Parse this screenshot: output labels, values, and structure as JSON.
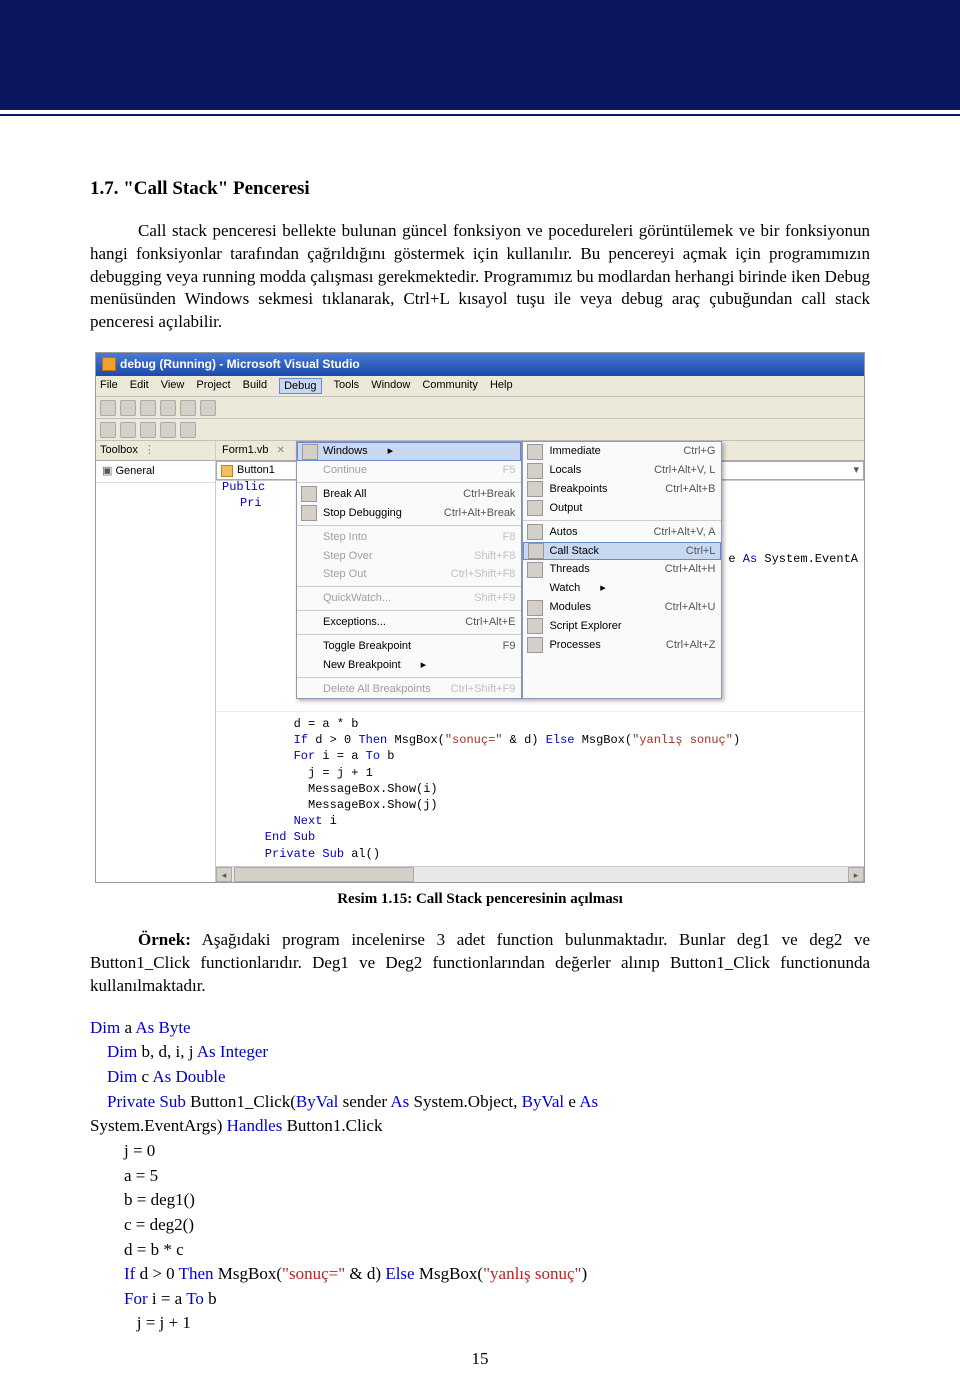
{
  "heading": "1.7. \"Call Stack\" Penceresi",
  "para1": "Call stack penceresi bellekte bulunan güncel fonksiyon ve pocedureleri görüntülemek ve bir fonksiyonun hangi fonksiyonlar tarafından çağrıldığını göstermek için kullanılır. Bu pencereyi açmak için programımızın debugging veya running modda çalışması gerekmektedir. Programımız bu modlardan herhangi birinde iken Debug menüsünden Windows sekmesi tıklanarak, Ctrl+L kısayol tuşu ile veya debug araç çubuğundan call stack penceresi açılabilir.",
  "shot": {
    "title": "debug (Running) - Microsoft Visual Studio",
    "menubar": [
      "File",
      "Edit",
      "View",
      "Project",
      "Build",
      "Debug",
      "Tools",
      "Window",
      "Community",
      "Help"
    ],
    "menubar_selected": "Debug",
    "toolbox": "Toolbox",
    "general": "General",
    "tab": "Form1.vb",
    "dd_button": "Button1",
    "debug_menu": [
      {
        "label": "Windows",
        "sel": true,
        "arrow": true
      },
      {
        "label": "Continue",
        "dis": true,
        "sc": "F5"
      },
      {
        "sep": true
      },
      {
        "label": "Break All",
        "sc": "Ctrl+Break",
        "icon": true
      },
      {
        "label": "Stop Debugging",
        "sc": "Ctrl+Alt+Break",
        "icon": true
      },
      {
        "sep": true
      },
      {
        "label": "Step Into",
        "dis": true,
        "sc": "F8"
      },
      {
        "label": "Step Over",
        "dis": true,
        "sc": "Shift+F8"
      },
      {
        "label": "Step Out",
        "dis": true,
        "sc": "Ctrl+Shift+F8"
      },
      {
        "sep": true
      },
      {
        "label": "QuickWatch...",
        "dis": true,
        "sc": "Shift+F9"
      },
      {
        "sep": true
      },
      {
        "label": "Exceptions...",
        "sc": "Ctrl+Alt+E"
      },
      {
        "sep": true
      },
      {
        "label": "Toggle Breakpoint",
        "sc": "F9"
      },
      {
        "label": "New Breakpoint",
        "arrow": true
      },
      {
        "sep": true
      },
      {
        "label": "Delete All Breakpoints",
        "dis": true,
        "sc": "Ctrl+Shift+F9"
      }
    ],
    "windows_menu": [
      {
        "label": "Immediate",
        "sc": "Ctrl+G",
        "icon": true
      },
      {
        "label": "Locals",
        "sc": "Ctrl+Alt+V, L",
        "icon": true
      },
      {
        "label": "Breakpoints",
        "sc": "Ctrl+Alt+B",
        "icon": true
      },
      {
        "label": "Output",
        "icon": true
      },
      {
        "sep": true
      },
      {
        "label": "Autos",
        "sc": "Ctrl+Alt+V, A",
        "icon": true
      },
      {
        "label": "Call Stack",
        "sc": "Ctrl+L",
        "sel": true,
        "icon": true
      },
      {
        "label": "Threads",
        "sc": "Ctrl+Alt+H",
        "icon": true
      },
      {
        "label": "Watch",
        "arrow": true
      },
      {
        "label": "Modules",
        "sc": "Ctrl+Alt+U",
        "icon": true
      },
      {
        "label": "Script Explorer",
        "icon": true
      },
      {
        "label": "Processes",
        "sc": "Ctrl+Alt+Z",
        "icon": true
      }
    ],
    "code_snippet": {
      "pub": "Public",
      "pri": "Pri",
      "byval": ", ByVal e As System.EventA",
      "l0": "        d = a * b",
      "l1a": "        If",
      "l1b": " d > 0 ",
      "l1c": "Then",
      "l1d": " MsgBox(",
      "l1e": "\"sonuç=\"",
      "l1f": " & d) ",
      "l1g": "Else",
      "l1h": " MsgBox(",
      "l1i": "\"yanlış sonuç\"",
      "l1j": ")",
      "l2a": "        For",
      "l2b": " i = a ",
      "l2c": "To",
      "l2d": " b",
      "l3": "          j = j + 1",
      "l4": "          MessageBox.Show(i)",
      "l5": "          MessageBox.Show(j)",
      "l6a": "        Next",
      "l6b": " i",
      "l7": "    End Sub",
      "l8a": "    Private Sub",
      "l8b": " al()"
    }
  },
  "caption": "Resim 1.15: Call Stack penceresinin açılması",
  "para2_lead": "Örnek:",
  "para2": " Aşağıdaki program incelenirse 3 adet function bulunmaktadır. Bunlar deg1 ve deg2 ve Button1_Click functionlarıdır. Deg1 ve Deg2 functionlarından değerler alınıp Button1_Click functionunda kullanılmaktadır.",
  "code": {
    "dim": "Dim",
    "as": "As",
    "byte": "Byte",
    "integer": "Integer",
    "double": "Double",
    "private": "Private",
    "sub": "Sub",
    "byval": "ByVal",
    "handles": "Handles",
    "if": "If",
    "then": "Then",
    "else": "Else",
    "for": "For",
    "to": "To",
    "a": " a ",
    "b_list": " b, d, i, j ",
    "c": " c ",
    "fn": " Button1_Click(",
    "sender": " sender ",
    "sysobj": " System.Object, ",
    "e": " e ",
    "sysargs": "System.EventArgs) ",
    "btn": " Button1.Click",
    "j0": "        j = 0",
    "a5": "        a = 5",
    "bd": "        b = deg1()",
    "cd": "        c = deg2()",
    "db": "        d = b * c",
    "if_pre": "        ",
    "if_mid": " d > 0 ",
    "msg1": " MsgBox(",
    "s1": "\"sonuç=\"",
    "amp": " & d) ",
    "msg2": " MsgBox(",
    "s2": "\"yanlış sonuç\"",
    "close": ")",
    "for_pre": "        ",
    "for_mid": " i = a ",
    "for_end": " b",
    "jj": "           j = j + 1"
  },
  "pagenum": "15"
}
